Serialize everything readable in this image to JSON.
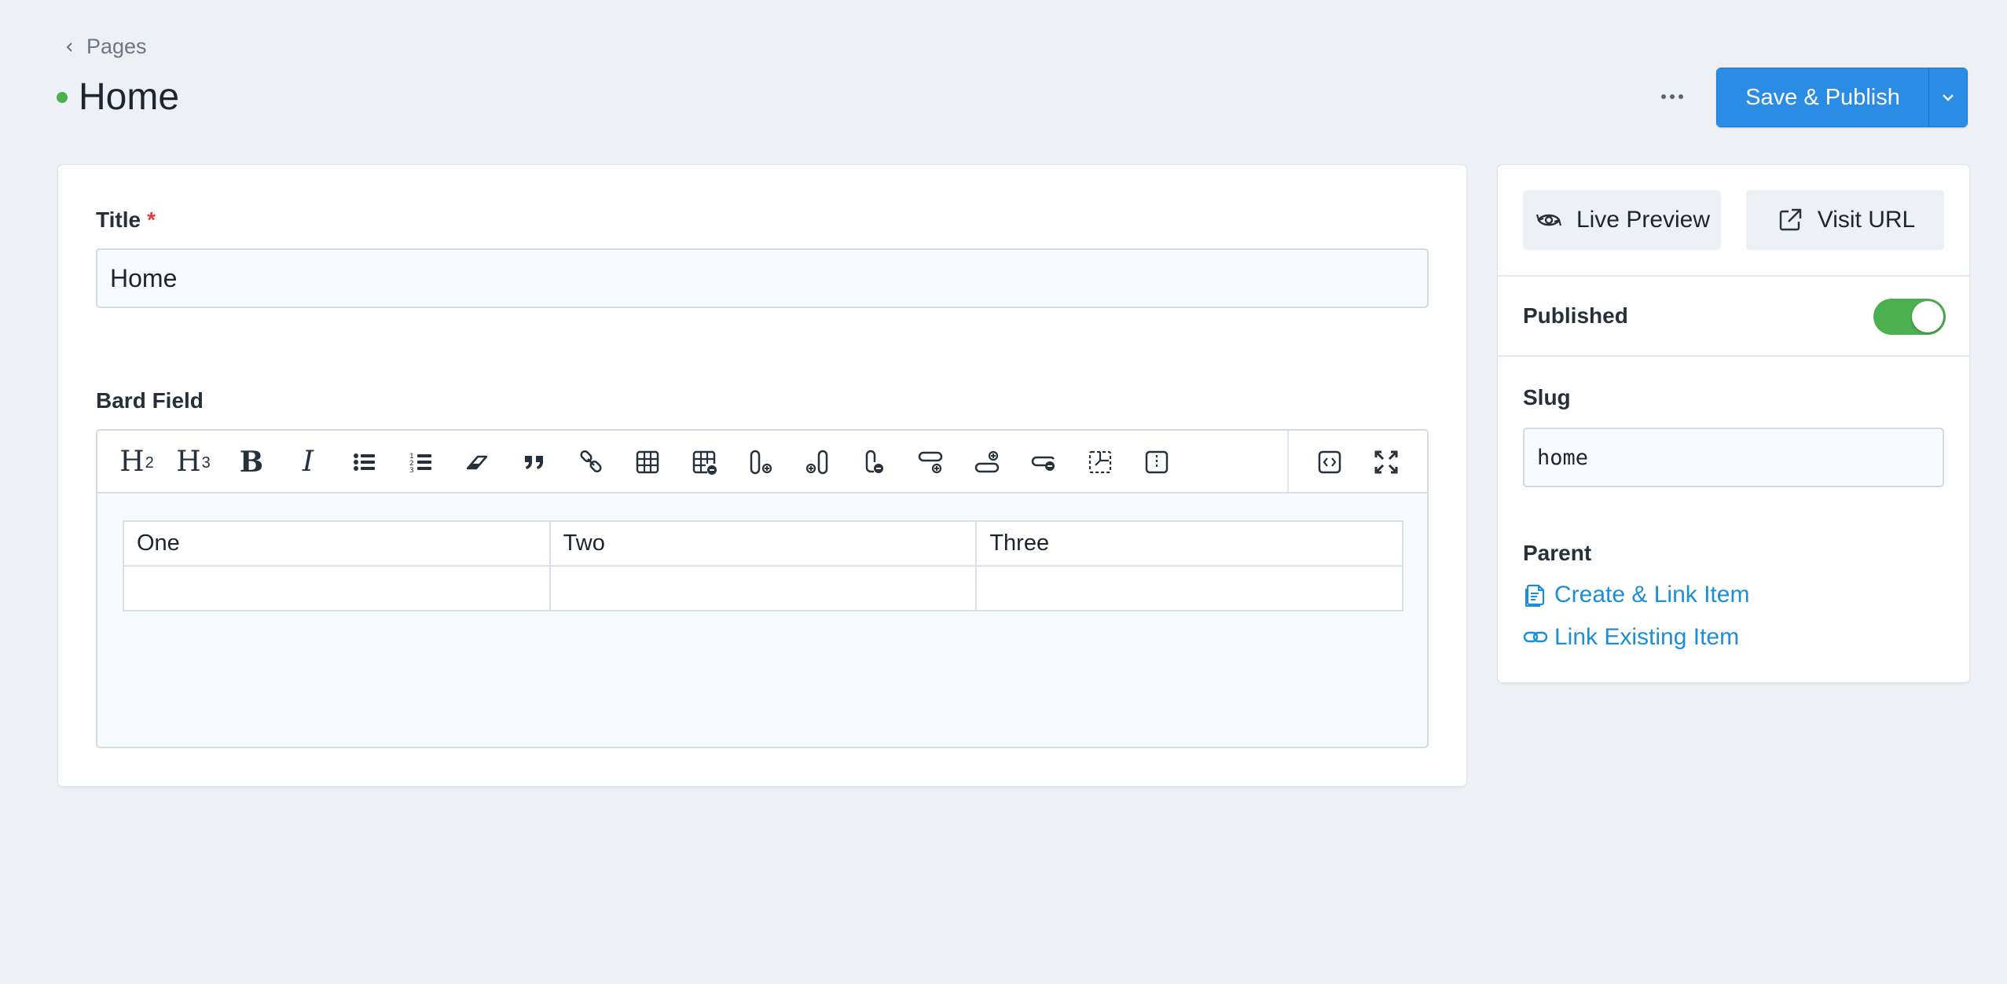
{
  "breadcrumb": {
    "label": "Pages"
  },
  "page": {
    "title": "Home",
    "status_color": "#4caf50"
  },
  "actions": {
    "save_publish_label": "Save & Publish"
  },
  "main": {
    "title_field": {
      "label": "Title",
      "required_marker": "*",
      "value": "Home"
    },
    "bard_field": {
      "label": "Bard Field",
      "toolbar": {
        "buttons": [
          "heading-2",
          "heading-3",
          "bold",
          "italic",
          "unordered-list",
          "ordered-list",
          "remove-format",
          "quote",
          "link",
          "table",
          "delete-table",
          "add-column-before",
          "add-column-after",
          "delete-column",
          "add-row-before",
          "add-row-after",
          "delete-row",
          "merge-cells",
          "split-cell",
          "code-view",
          "fullscreen"
        ],
        "h2_label": "H",
        "h2_sup": "2",
        "h3_label": "H",
        "h3_sup": "3",
        "bold_label": "B",
        "italic_label": "I"
      },
      "table": {
        "rows": [
          [
            "One",
            "Two",
            "Three"
          ],
          [
            "",
            "",
            ""
          ]
        ]
      }
    }
  },
  "sidebar": {
    "live_preview_label": "Live Preview",
    "visit_url_label": "Visit URL",
    "published": {
      "label": "Published",
      "value": true
    },
    "slug": {
      "label": "Slug",
      "value": "home"
    },
    "parent": {
      "label": "Parent",
      "create_link_label": "Create & Link Item",
      "link_existing_label": "Link Existing Item"
    }
  },
  "colors": {
    "accent": "#2b8ce6",
    "link": "#1c8ed6",
    "toggle_on": "#4caf50",
    "required": "#e53b3b"
  }
}
